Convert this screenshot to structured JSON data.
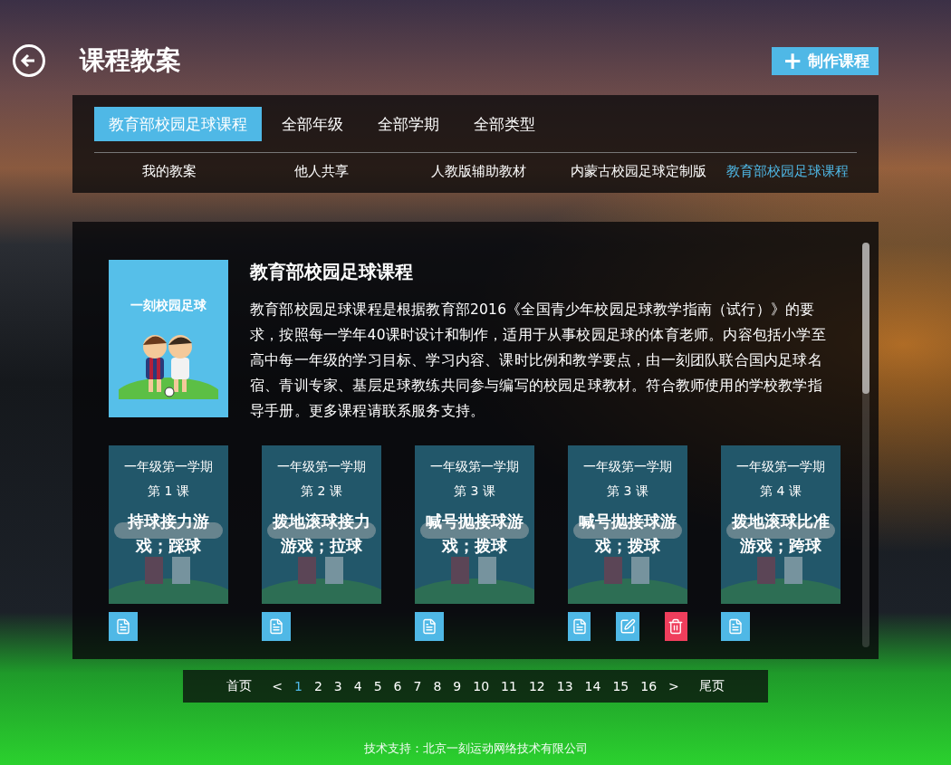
{
  "header": {
    "title": "课程教案",
    "create_button": {
      "icon": "+",
      "label": "制作课程"
    }
  },
  "filters": {
    "tabs": [
      {
        "label": "教育部校园足球课程",
        "selected": true
      },
      {
        "label": "全部年级",
        "selected": false
      },
      {
        "label": "全部学期",
        "selected": false
      },
      {
        "label": "全部类型",
        "selected": false
      }
    ],
    "sub_tabs": [
      {
        "label": "我的教案",
        "selected": false
      },
      {
        "label": "他人共享",
        "selected": false
      },
      {
        "label": "人教版辅助教材",
        "selected": false
      },
      {
        "label": "内蒙古校园足球定制版",
        "selected": false
      },
      {
        "label": "教育部校园足球课程",
        "selected": true
      }
    ]
  },
  "course": {
    "cover_title": "一刻校园足球",
    "title": "教育部校园足球课程",
    "description": "教育部校园足球课程是根据教育部2016《全国青少年校园足球教学指南（试行）》的要求，按照每一学年40课时设计和制作，适用于从事校园足球的体育老师。内容包括小学至高中每一年级的学习目标、学习内容、课时比例和教学要点，由一刻团队联合国内足球名宿、青训专家、基层足球教练共同参与编写的校园足球教材。符合教师使用的学校教学指导手册。更多课程请联系服务支持。"
  },
  "lessons": [
    {
      "term": "一年级第一学期",
      "lesson": "第 1 课",
      "title": "持球接力游戏；踩球",
      "actions": [
        {
          "kind": "copy"
        }
      ]
    },
    {
      "term": "一年级第一学期",
      "lesson": "第 2 课",
      "title": "拨地滚球接力游戏；拉球",
      "actions": [
        {
          "kind": "copy"
        }
      ]
    },
    {
      "term": "一年级第一学期",
      "lesson": "第 3 课",
      "title": "喊号抛接球游戏；拨球",
      "actions": [
        {
          "kind": "copy"
        }
      ]
    },
    {
      "term": "一年级第一学期",
      "lesson": "第 3 课",
      "title": "喊号抛接球游戏；拨球",
      "actions": [
        {
          "kind": "copy"
        },
        {
          "kind": "edit"
        },
        {
          "kind": "delete"
        }
      ]
    },
    {
      "term": "一年级第一学期",
      "lesson": "第 4 课",
      "title": "拨地滚球比准游戏；跨球",
      "actions": [
        {
          "kind": "copy"
        }
      ]
    }
  ],
  "pagination": {
    "first": "首页",
    "prev": "<",
    "pages": [
      {
        "label": "1",
        "selected": true
      },
      {
        "label": "2",
        "selected": false
      },
      {
        "label": "3",
        "selected": false
      },
      {
        "label": "4",
        "selected": false
      },
      {
        "label": "5",
        "selected": false
      },
      {
        "label": "6",
        "selected": false
      },
      {
        "label": "7",
        "selected": false
      },
      {
        "label": "8",
        "selected": false
      },
      {
        "label": "9",
        "selected": false
      },
      {
        "label": "10",
        "selected": false
      },
      {
        "label": "11",
        "selected": false
      },
      {
        "label": "12",
        "selected": false
      },
      {
        "label": "13",
        "selected": false
      },
      {
        "label": "14",
        "selected": false
      },
      {
        "label": "15",
        "selected": false
      },
      {
        "label": "16",
        "selected": false
      }
    ],
    "next": ">",
    "last": "尾页"
  },
  "footer": "技术支持：北京一刻运动网络技术有限公司"
}
